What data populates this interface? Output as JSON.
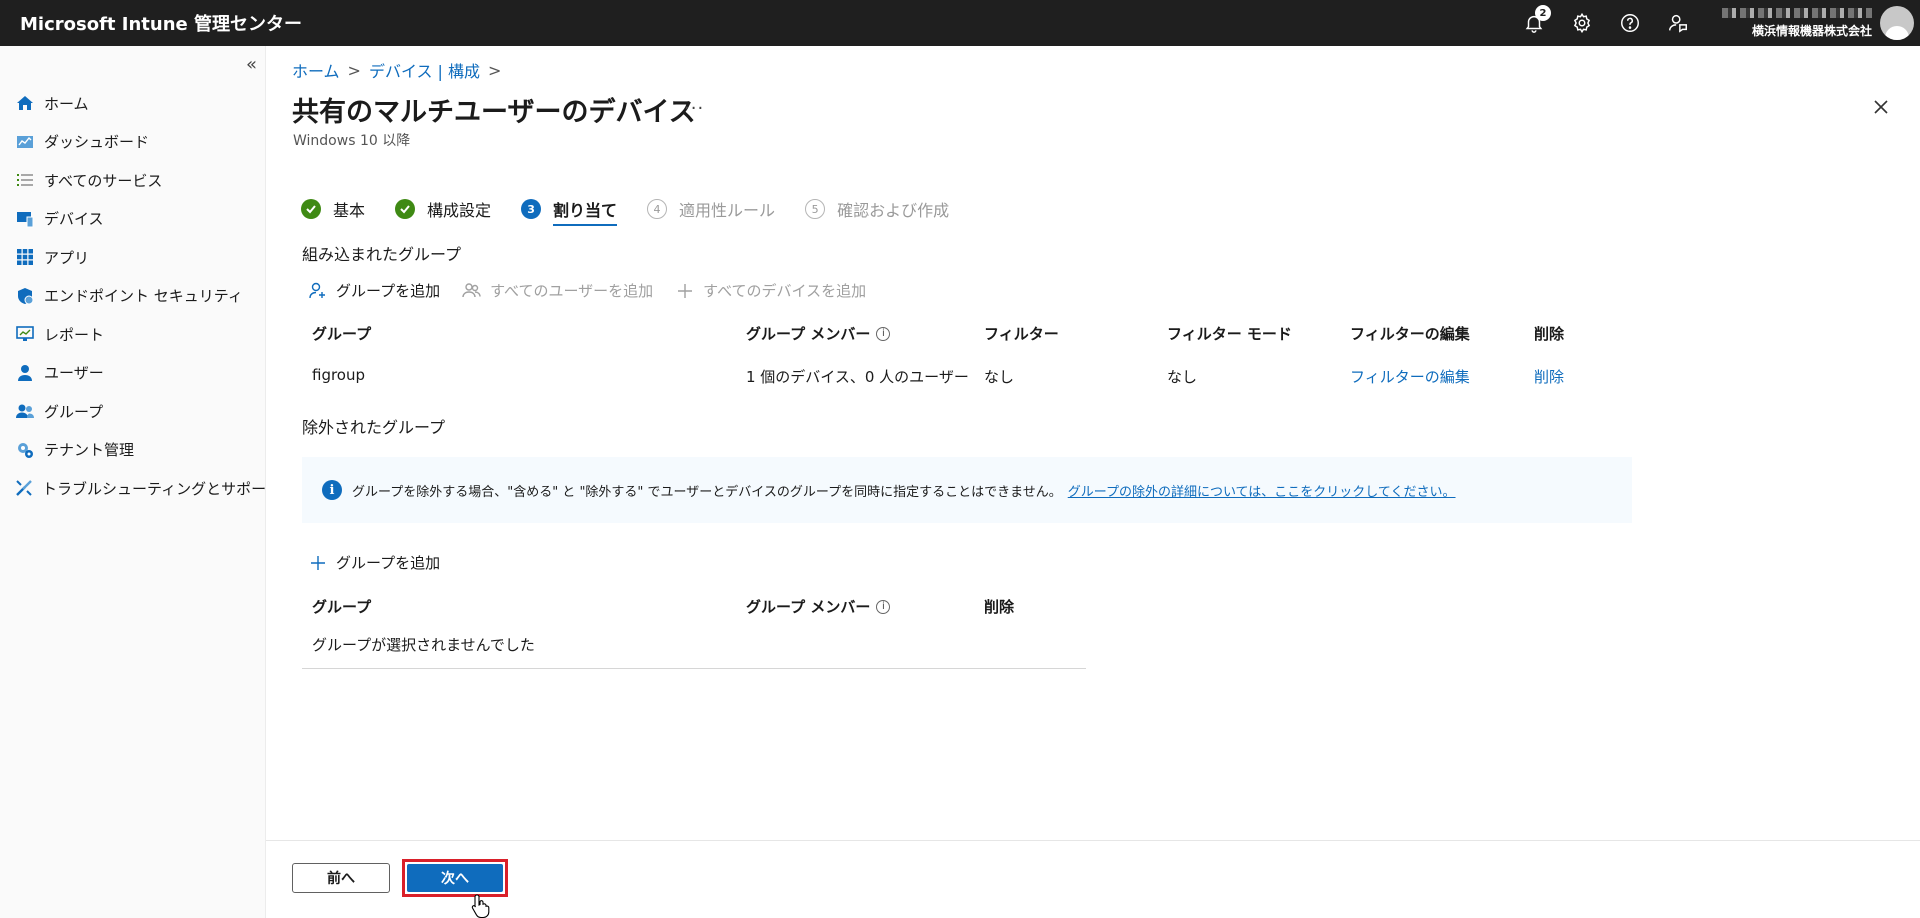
{
  "topbar": {
    "app_title": "Microsoft Intune 管理センター",
    "notification_count": "2",
    "org_name": "横浜情報機器株式会社"
  },
  "sidebar": {
    "collapse_glyph": "«",
    "items": [
      {
        "label": "ホーム",
        "icon": "home-icon"
      },
      {
        "label": "ダッシュボード",
        "icon": "dashboard-icon"
      },
      {
        "label": "すべてのサービス",
        "icon": "list-icon"
      },
      {
        "label": "デバイス",
        "icon": "devices-icon"
      },
      {
        "label": "アプリ",
        "icon": "apps-icon"
      },
      {
        "label": "エンドポイント セキュリティ",
        "icon": "shield-icon"
      },
      {
        "label": "レポート",
        "icon": "reports-icon"
      },
      {
        "label": "ユーザー",
        "icon": "user-icon"
      },
      {
        "label": "グループ",
        "icon": "group-icon"
      },
      {
        "label": "テナント管理",
        "icon": "tenant-icon"
      },
      {
        "label": "トラブルシューティングとサポート",
        "icon": "wrench-icon"
      }
    ]
  },
  "breadcrumb": {
    "home": "ホーム",
    "devices": "デバイス | 構成"
  },
  "page": {
    "title": "共有のマルチユーザーのデバイス",
    "more": "···",
    "subtitle": "Windows 10 以降"
  },
  "steps": [
    {
      "label": "基本",
      "state": "done",
      "num": ""
    },
    {
      "label": "構成設定",
      "state": "done",
      "num": ""
    },
    {
      "label": "割り当て",
      "state": "current",
      "num": "3"
    },
    {
      "label": "適用性ルール",
      "state": "todo",
      "num": "4"
    },
    {
      "label": "確認および作成",
      "state": "todo",
      "num": "5"
    }
  ],
  "included": {
    "title": "組み込まれたグループ",
    "cmd_add_group": "グループを追加",
    "cmd_add_all_users": "すべてのユーザーを追加",
    "cmd_add_all_devices": "すべてのデバイスを追加",
    "headers": {
      "group": "グループ",
      "members": "グループ メンバー",
      "filter": "フィルター",
      "filter_mode": "フィルター モード",
      "edit_filter": "フィルターの編集",
      "delete": "削除"
    },
    "rows": [
      {
        "group": "figroup",
        "members": "1 個のデバイス、0 人のユーザー",
        "filter": "なし",
        "filter_mode": "なし",
        "edit_filter": "フィルターの編集",
        "delete": "削除"
      }
    ]
  },
  "excluded": {
    "title": "除外されたグループ",
    "info_text": "グループを除外する場合、\"含める\" と \"除外する\" でユーザーとデバイスのグループを同時に指定することはできません。",
    "info_link": "グループの除外の詳細については、ここをクリックしてください。",
    "cmd_add_group": "グループを追加",
    "headers": {
      "group": "グループ",
      "members": "グループ メンバー",
      "delete": "削除"
    },
    "empty": "グループが選択されませんでした"
  },
  "footer": {
    "prev": "前へ",
    "next": "次へ"
  },
  "colors": {
    "accent": "#0f6cbd",
    "success": "#3f8a14",
    "highlight": "#d9202a",
    "topbar": "#1f1f1f"
  }
}
